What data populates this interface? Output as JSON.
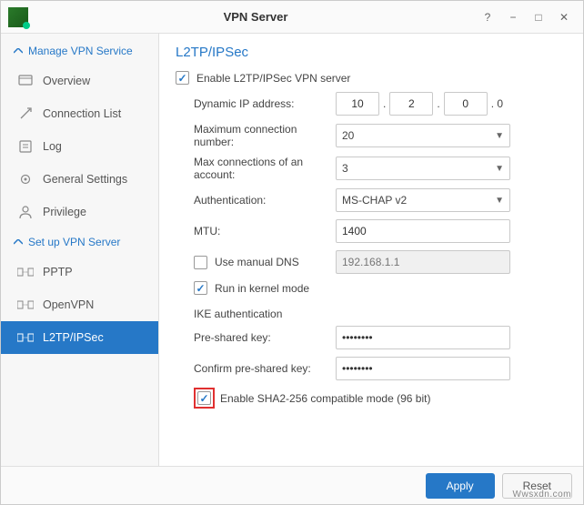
{
  "window": {
    "title": "VPN Server"
  },
  "sidebar": {
    "section1": {
      "title": "Manage VPN Service"
    },
    "items1": [
      {
        "label": "Overview"
      },
      {
        "label": "Connection List"
      },
      {
        "label": "Log"
      },
      {
        "label": "General Settings"
      },
      {
        "label": "Privilege"
      }
    ],
    "section2": {
      "title": "Set up VPN Server"
    },
    "items2": [
      {
        "label": "PPTP"
      },
      {
        "label": "OpenVPN"
      },
      {
        "label": "L2TP/IPSec"
      }
    ]
  },
  "page": {
    "title": "L2TP/IPSec",
    "enable_label": "Enable L2TP/IPSec VPN server",
    "dynamic_ip_label": "Dynamic IP address:",
    "ip": {
      "a": "10",
      "b": "2",
      "c": "0",
      "suffix": ". 0"
    },
    "max_conn_label": "Maximum connection number:",
    "max_conn_value": "20",
    "max_acct_label": "Max connections of an account:",
    "max_acct_value": "3",
    "auth_label": "Authentication:",
    "auth_value": "MS-CHAP v2",
    "mtu_label": "MTU:",
    "mtu_value": "1400",
    "manual_dns_label": "Use manual DNS",
    "manual_dns_placeholder": "192.168.1.1",
    "kernel_label": "Run in kernel mode",
    "ike_label": "IKE authentication",
    "psk_label": "Pre-shared key:",
    "psk_value": "••••••••",
    "psk2_label": "Confirm pre-shared key:",
    "psk2_value": "••••••••",
    "sha_label": "Enable SHA2-256 compatible mode (96 bit)"
  },
  "footer": {
    "apply": "Apply",
    "reset": "Reset"
  },
  "watermark": "Wwsxdn.com"
}
